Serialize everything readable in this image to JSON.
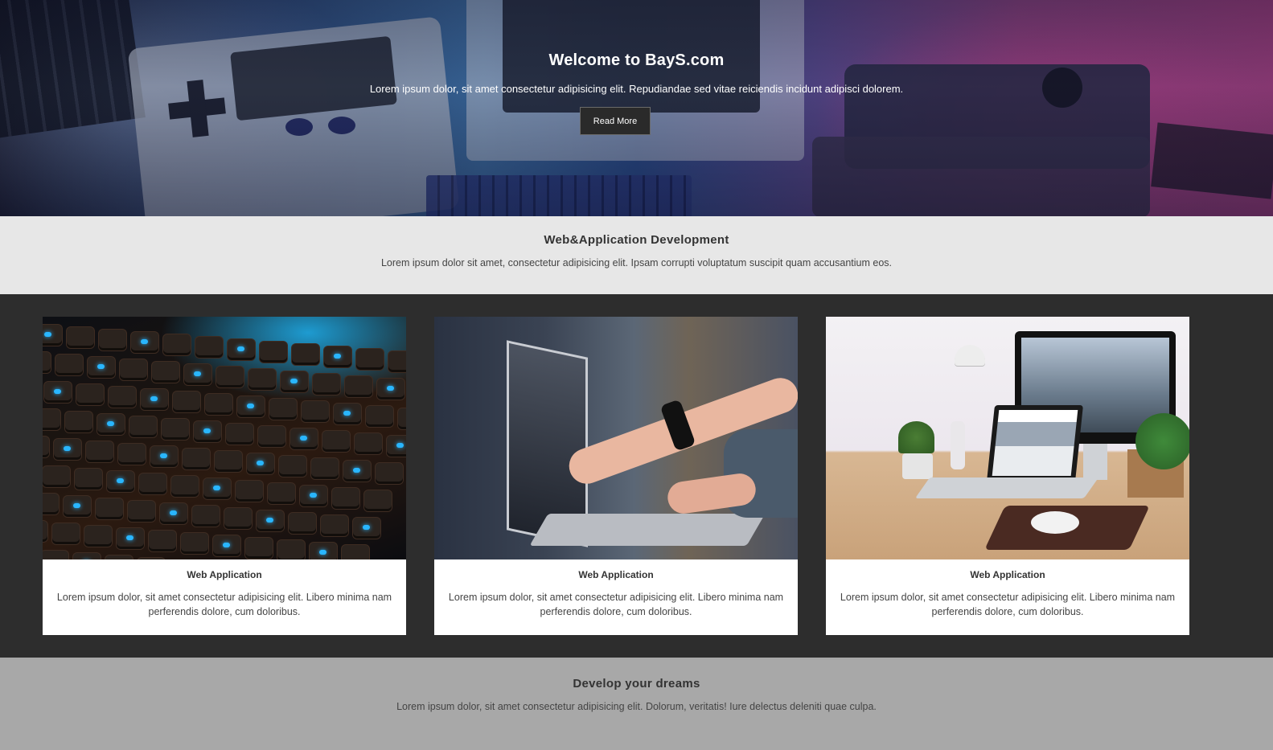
{
  "hero": {
    "title": "Welcome to BayS.com",
    "subtitle": "Lorem ipsum dolor, sit amet consectetur adipisicing elit. Repudiandae sed vitae reiciendis incidunt adipisci dolorem.",
    "button_label": "Read More"
  },
  "intro": {
    "title": "Web&Application Development",
    "text": "Lorem ipsum dolor sit amet, consectetur adipisicing elit. Ipsam corrupti voluptatum suscipit quam accusantium eos."
  },
  "cards": [
    {
      "image_icon": "keyboard-photo",
      "title": "Web Application",
      "text": "Lorem ipsum dolor, sit amet consectetur adipisicing elit. Libero minima nam perferendis dolore, cum doloribus."
    },
    {
      "image_icon": "laptop-hands-photo",
      "title": "Web Application",
      "text": "Lorem ipsum dolor, sit amet consectetur adipisicing elit. Libero minima nam perferendis dolore, cum doloribus."
    },
    {
      "image_icon": "desk-setup-photo",
      "title": "Web Application",
      "text": "Lorem ipsum dolor, sit amet consectetur adipisicing elit. Libero minima nam perferendis dolore, cum doloribus."
    }
  ],
  "dreams": {
    "title": "Develop your dreams",
    "text": "Lorem ipsum dolor, sit amet consectetur adipisicing elit. Dolorum, veritatis! Iure delectus deleniti quae culpa."
  },
  "colors": {
    "intro_bg": "#e7e7e7",
    "cards_bg": "#2d2d2d",
    "dreams_bg": "#a8a8a8",
    "button_bg": "#2a2a2a"
  }
}
